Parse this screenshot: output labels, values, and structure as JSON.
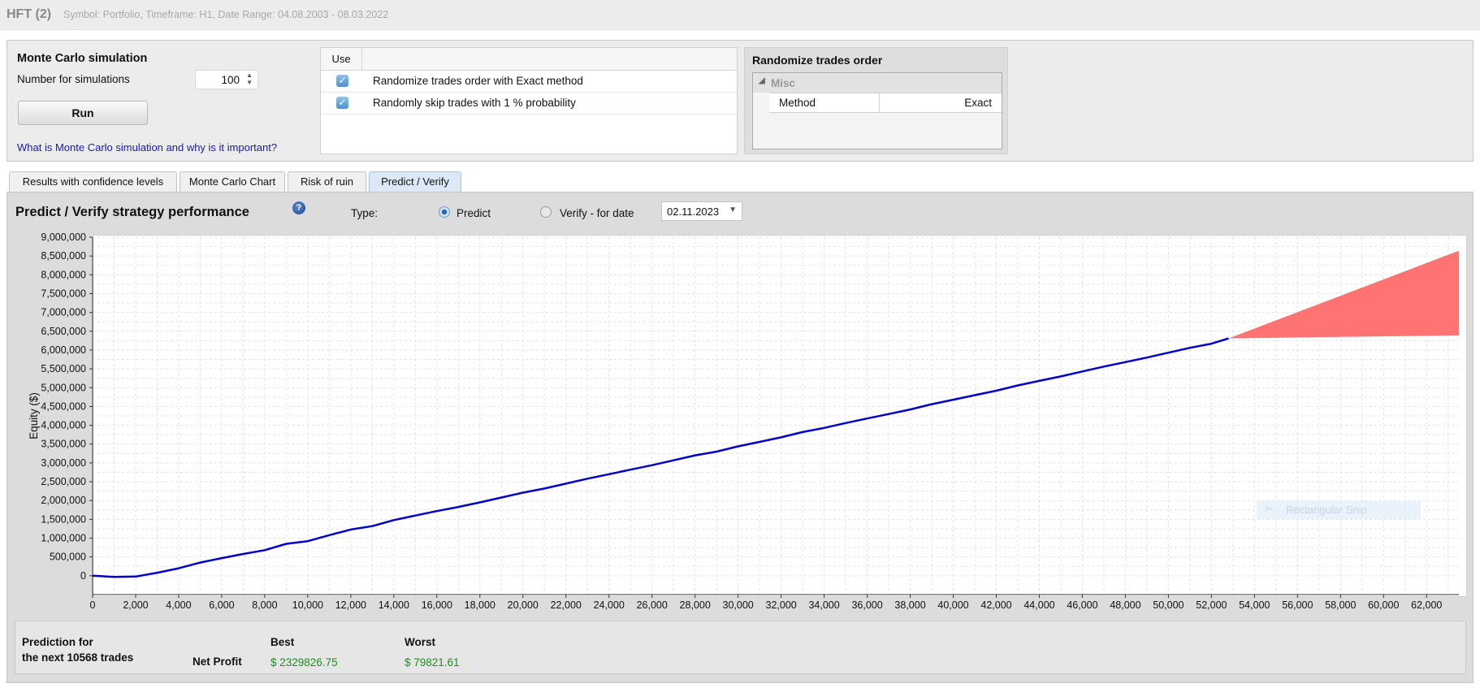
{
  "header": {
    "title": "HFT (2)",
    "subtitle": "Symbol: Portfolio, Timeframe: H1, Date Range: 04.08.2003 - 08.03.2022"
  },
  "monte_carlo": {
    "title": "Monte Carlo simulation",
    "num_label": "Number for simulations",
    "num_value": "100",
    "run_label": "Run",
    "help_link": "What is Monte Carlo simulation and why is it important?"
  },
  "use_table": {
    "header": "Use",
    "rows": [
      {
        "label": "Randomize trades order with Exact method",
        "checked": true
      },
      {
        "label": "Randomly skip trades with 1 % probability",
        "checked": true
      }
    ]
  },
  "randomize": {
    "title": "Randomize trades order",
    "group": "Misc",
    "prop_name": "Method",
    "prop_value": "Exact"
  },
  "tabs": [
    "Results with confidence levels",
    "Monte Carlo Chart",
    "Risk of ruin",
    "Predict / Verify"
  ],
  "active_tab": 3,
  "predict": {
    "title": "Predict / Verify strategy performance",
    "type_label": "Type:",
    "opt_predict": "Predict",
    "opt_verify": "Verify - for date",
    "date": "02.11.2023",
    "selected": "Predict"
  },
  "chart_data": {
    "type": "line",
    "ylabel": "Equity ($)",
    "xlim": [
      0,
      63500
    ],
    "ylim": [
      -500000,
      9000000
    ],
    "y_ticks": [
      0,
      500000,
      1000000,
      1500000,
      2000000,
      2500000,
      3000000,
      3500000,
      4000000,
      4500000,
      5000000,
      5500000,
      6000000,
      6500000,
      7000000,
      7500000,
      8000000,
      8500000,
      9000000
    ],
    "y_tick_labels": [
      "0",
      "500,000",
      "1,000,000",
      "1,500,000",
      "2,000,000",
      "2,500,000",
      "3,000,000",
      "3,500,000",
      "4,000,000",
      "4,500,000",
      "5,000,000",
      "5,500,000",
      "6,000,000",
      "6,500,000",
      "7,000,000",
      "7,500,000",
      "8,000,000",
      "8,500,000",
      "9,000,000"
    ],
    "x_ticks": [
      0,
      2000,
      4000,
      6000,
      8000,
      10000,
      12000,
      14000,
      16000,
      18000,
      20000,
      22000,
      24000,
      26000,
      28000,
      30000,
      32000,
      34000,
      36000,
      38000,
      40000,
      42000,
      44000,
      46000,
      48000,
      50000,
      52000,
      54000,
      56000,
      58000,
      60000,
      62000
    ],
    "x_tick_labels": [
      "0",
      "2,000",
      "4,000",
      "6,000",
      "8,000",
      "10,000",
      "12,000",
      "14,000",
      "16,000",
      "18,000",
      "20,000",
      "22,000",
      "24,000",
      "26,000",
      "28,000",
      "30,000",
      "32,000",
      "34,000",
      "36,000",
      "38,000",
      "40,000",
      "42,000",
      "44,000",
      "46,000",
      "48,000",
      "50,000",
      "52,000",
      "54,000",
      "56,000",
      "58,000",
      "60,000",
      "62,000"
    ],
    "grid": true,
    "series": [
      {
        "color": "#0000cc",
        "points": [
          [
            0,
            0
          ],
          [
            1000,
            -30000
          ],
          [
            2000,
            -20000
          ],
          [
            3000,
            80000
          ],
          [
            4000,
            200000
          ],
          [
            5000,
            350000
          ],
          [
            6000,
            470000
          ],
          [
            7000,
            580000
          ],
          [
            8000,
            680000
          ],
          [
            9000,
            850000
          ],
          [
            10000,
            920000
          ],
          [
            11000,
            1080000
          ],
          [
            12000,
            1230000
          ],
          [
            13000,
            1320000
          ],
          [
            14000,
            1480000
          ],
          [
            15000,
            1600000
          ],
          [
            16000,
            1720000
          ],
          [
            17000,
            1830000
          ],
          [
            18000,
            1950000
          ],
          [
            19000,
            2080000
          ],
          [
            20000,
            2210000
          ],
          [
            21000,
            2320000
          ],
          [
            22000,
            2450000
          ],
          [
            23000,
            2580000
          ],
          [
            24000,
            2700000
          ],
          [
            25000,
            2820000
          ],
          [
            26000,
            2940000
          ],
          [
            27000,
            3070000
          ],
          [
            28000,
            3200000
          ],
          [
            29000,
            3300000
          ],
          [
            30000,
            3440000
          ],
          [
            31000,
            3560000
          ],
          [
            32000,
            3680000
          ],
          [
            33000,
            3820000
          ],
          [
            34000,
            3930000
          ],
          [
            35000,
            4060000
          ],
          [
            36000,
            4180000
          ],
          [
            37000,
            4300000
          ],
          [
            38000,
            4420000
          ],
          [
            39000,
            4560000
          ],
          [
            40000,
            4680000
          ],
          [
            41000,
            4800000
          ],
          [
            42000,
            4920000
          ],
          [
            43000,
            5060000
          ],
          [
            44000,
            5180000
          ],
          [
            45000,
            5300000
          ],
          [
            46000,
            5430000
          ],
          [
            47000,
            5560000
          ],
          [
            48000,
            5680000
          ],
          [
            49000,
            5800000
          ],
          [
            50000,
            5930000
          ],
          [
            51000,
            6060000
          ],
          [
            52000,
            6170000
          ],
          [
            52800,
            6310000
          ]
        ]
      }
    ],
    "prediction_band": {
      "color": "#ff7373",
      "start": [
        52800,
        6310000
      ],
      "end_x": 63500,
      "best": 8640000,
      "worst": 6390000
    }
  },
  "prediction": {
    "label_line1": "Prediction for",
    "label_line2": "the next 10568 trades",
    "metric": "Net Profit",
    "best_label": "Best",
    "worst_label": "Worst",
    "best_value": "$ 2329826.75",
    "worst_value": "$ 79821.61"
  },
  "overlay": {
    "text": "Rectangular Snip"
  }
}
